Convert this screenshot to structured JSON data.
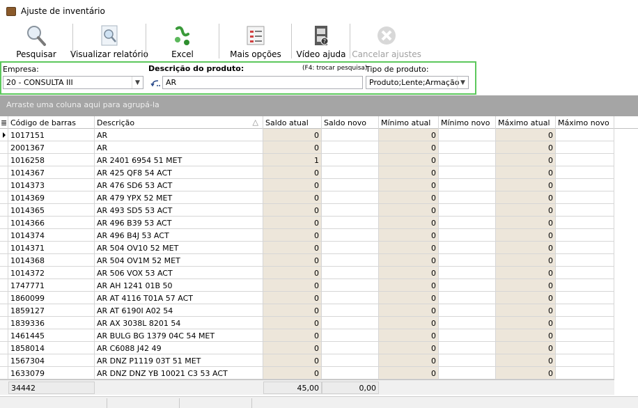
{
  "window": {
    "title": "Ajuste de inventário"
  },
  "toolbar": {
    "buttons": [
      {
        "label": "Pesquisar",
        "icon": "magnifier-icon",
        "enabled": true
      },
      {
        "label": "Visualizar relatório",
        "icon": "report-preview-icon",
        "enabled": true
      },
      {
        "label": "Excel",
        "icon": "excel-icon",
        "enabled": true
      },
      {
        "label": "Mais opções",
        "icon": "checklist-icon",
        "enabled": true
      },
      {
        "label": "Vídeo ajuda",
        "icon": "video-help-icon",
        "enabled": true
      },
      {
        "label": "Cancelar ajustes",
        "icon": "cancel-icon",
        "enabled": false
      }
    ]
  },
  "filters": {
    "empresa_label": "Empresa:",
    "empresa_value": "20 - CONSULTA III",
    "descricao_label": "Descrição do produto:",
    "descricao_hint": "(F4: trocar pesquisa)",
    "descricao_value": "AR",
    "tipo_label": "Tipo de produto:",
    "tipo_value": "Produto;Lente;Armação",
    "highlight_color": "#5cc85c"
  },
  "group_panel": {
    "text": "Arraste uma coluna aqui para agrupá-la"
  },
  "grid": {
    "columns": [
      "Código de barras",
      "Descrição",
      "Saldo atual",
      "Saldo novo",
      "Mínimo atual",
      "Mínimo novo",
      "Máximo atual",
      "Máximo novo"
    ],
    "sort_indicator": "△",
    "rows": [
      {
        "code": "1017151",
        "desc": "AR",
        "saldo": "0",
        "minimo": "0",
        "maximo": "0"
      },
      {
        "code": "2001367",
        "desc": "AR",
        "saldo": "0",
        "minimo": "0",
        "maximo": "0"
      },
      {
        "code": "1016258",
        "desc": "AR  2401 6954 51 MET",
        "saldo": "1",
        "minimo": "0",
        "maximo": "0"
      },
      {
        "code": "1014367",
        "desc": "AR  425 QF8 54 ACT",
        "saldo": "0",
        "minimo": "0",
        "maximo": "0"
      },
      {
        "code": "1014373",
        "desc": "AR  476 SD6 53 ACT",
        "saldo": "0",
        "minimo": "0",
        "maximo": "0"
      },
      {
        "code": "1014369",
        "desc": "AR  479 YPX 52 MET",
        "saldo": "0",
        "minimo": "0",
        "maximo": "0"
      },
      {
        "code": "1014365",
        "desc": "AR  493 SD5 53 ACT",
        "saldo": "0",
        "minimo": "0",
        "maximo": "0"
      },
      {
        "code": "1014366",
        "desc": "AR  496 B39 53 ACT",
        "saldo": "0",
        "minimo": "0",
        "maximo": "0"
      },
      {
        "code": "1014374",
        "desc": "AR  496 B4J 53 ACT",
        "saldo": "0",
        "minimo": "0",
        "maximo": "0"
      },
      {
        "code": "1014371",
        "desc": "AR  504 OV10 52 MET",
        "saldo": "0",
        "minimo": "0",
        "maximo": "0"
      },
      {
        "code": "1014368",
        "desc": "AR  504 OV1M 52 MET",
        "saldo": "0",
        "minimo": "0",
        "maximo": "0"
      },
      {
        "code": "1014372",
        "desc": "AR  506 VOX 53 ACT",
        "saldo": "0",
        "minimo": "0",
        "maximo": "0"
      },
      {
        "code": "1747771",
        "desc": "AR  AH  1241 01B 50",
        "saldo": "0",
        "minimo": "0",
        "maximo": "0"
      },
      {
        "code": "1860099",
        "desc": "AR  AT 4116 T01A 57  ACT",
        "saldo": "0",
        "minimo": "0",
        "maximo": "0"
      },
      {
        "code": "1859127",
        "desc": "AR  AT 6190I A02 54",
        "saldo": "0",
        "minimo": "0",
        "maximo": "0"
      },
      {
        "code": "1839336",
        "desc": "AR  AX 3038L 8201 54",
        "saldo": "0",
        "minimo": "0",
        "maximo": "0"
      },
      {
        "code": "1461445",
        "desc": "AR  BULG BG 1379 04C 54 MET",
        "saldo": "0",
        "minimo": "0",
        "maximo": "0"
      },
      {
        "code": "1858014",
        "desc": "AR  C6088 J42 49",
        "saldo": "0",
        "minimo": "0",
        "maximo": "0"
      },
      {
        "code": "1567304",
        "desc": "AR  DNZ  P1119 03T 51 MET",
        "saldo": "0",
        "minimo": "0",
        "maximo": "0"
      },
      {
        "code": "1633079",
        "desc": "AR  DNZ DNZ YB 10021 C3 53 ACT",
        "saldo": "0",
        "minimo": "0",
        "maximo": "0"
      }
    ],
    "footer": {
      "count": "34442",
      "saldo_total": "45,00",
      "saldo_novo_total": "0,00"
    }
  }
}
